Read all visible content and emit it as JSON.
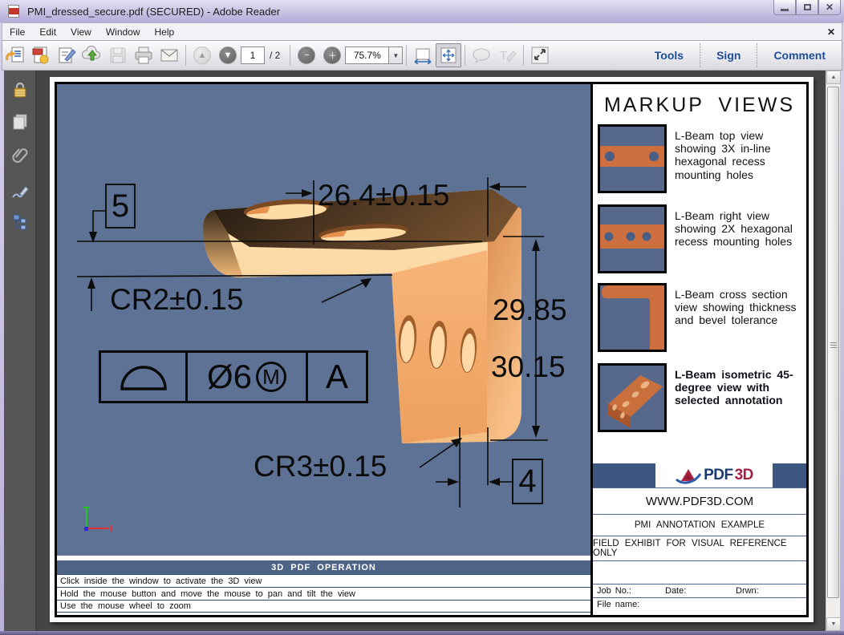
{
  "window": {
    "title": "PMI_dressed_secure.pdf (SECURED) - Adobe Reader"
  },
  "menu": {
    "items": [
      "File",
      "Edit",
      "View",
      "Window",
      "Help"
    ],
    "close_glyph": "✕"
  },
  "toolbar": {
    "page_current": "1",
    "page_total": "/ 2",
    "zoom": "75.7%",
    "tools_label": "Tools",
    "sign_label": "Sign",
    "comment_label": "Comment",
    "icon_names": [
      "open-icon",
      "create-pdf-icon",
      "sign-document-icon",
      "cloud-upload-icon",
      "save-icon",
      "print-icon",
      "email-icon",
      "previous-page-icon",
      "next-page-icon",
      "zoom-out-icon",
      "zoom-in-icon",
      "fit-width-icon",
      "fit-page-icon",
      "comment-bubble-icon",
      "text-callout-icon",
      "fullscreen-icon"
    ]
  },
  "nav_icons": [
    "security-lock-icon",
    "page-thumbnails-icon",
    "attachments-icon",
    "signatures-icon",
    "layers-icon"
  ],
  "viewport": {
    "background": "#5e7295",
    "annotations": {
      "width_dim": "26.4±0.15",
      "flange_thickness": "5",
      "top_radius": "CR2±0.15",
      "height_upper": "29.85",
      "height_lower": "30.15",
      "bottom_radius": "CR3±0.15",
      "web_thickness": "4",
      "fcf": {
        "symbol": "profile-of-a-surface",
        "tolerance": "Ø6",
        "modifier": "M",
        "datum": "A"
      }
    }
  },
  "markup_views": {
    "title": "MARKUP  VIEWS",
    "items": [
      {
        "caption": "L-Beam top view showing 3X in-line hexagonal recess mounting holes"
      },
      {
        "caption": "L-Beam right view showing 2X hexagonal recess mounting holes"
      },
      {
        "caption": "L-Beam cross section view showing thickness and bevel tolerance"
      },
      {
        "caption": "L-Beam isometric 45-degree view with selected annotation"
      }
    ]
  },
  "operation": {
    "title": "3D PDF OPERATION",
    "lines": [
      "Click inside the window to activate the 3D view",
      "Hold the mouse button and move the mouse to pan and tilt the view",
      "Use the mouse wheel to zoom"
    ]
  },
  "title_block": {
    "brand_pdf": "PDF",
    "brand_3d": "3D",
    "website": "WWW.PDF3D.COM",
    "subtitle": "PMI ANNOTATION EXAMPLE",
    "note": "FIELD EXHIBIT FOR VISUAL REFERENCE ONLY",
    "job_label": "Job No.:",
    "date_label": "Date:",
    "drawn_label": "Drwn:",
    "file_label": "File name:"
  },
  "colors": {
    "viewport_blue": "#5e7295",
    "thumb_blue": "#56698c",
    "beam_orange": "#f2a96b",
    "slate_bar": "#4d6486",
    "logo_navy": "#1b3a70",
    "logo_red": "#a31f44",
    "link_blue": "#1f4e96"
  }
}
